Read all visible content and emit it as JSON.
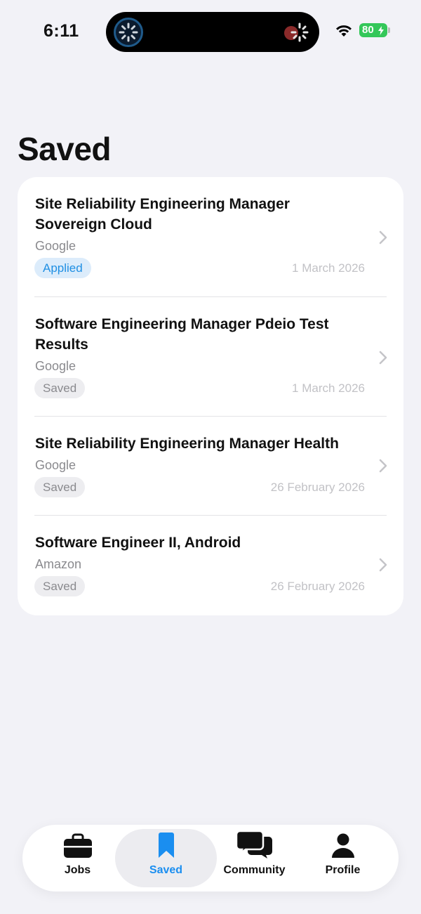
{
  "status_bar": {
    "time": "6:11",
    "battery": "80"
  },
  "page": {
    "title": "Saved"
  },
  "jobs": [
    {
      "title": "Site Reliability Engineering Manager Sovereign Cloud",
      "company": "Google",
      "status": "Applied",
      "date": "1 March 2026"
    },
    {
      "title": "Software Engineering Manager Pdeio Test Results",
      "company": "Google",
      "status": "Saved",
      "date": "1 March 2026"
    },
    {
      "title": "Site Reliability Engineering Manager Health",
      "company": "Google",
      "status": "Saved",
      "date": "26 February 2026"
    },
    {
      "title": "Software Engineer II, Android",
      "company": "Amazon",
      "status": "Saved",
      "date": "26 February 2026"
    }
  ],
  "tabbar": {
    "active": "saved",
    "tabs": [
      {
        "label": "Jobs",
        "icon": "briefcase-icon"
      },
      {
        "label": "Saved",
        "icon": "bookmark-icon"
      },
      {
        "label": "Community",
        "icon": "chat-bubbles-icon"
      },
      {
        "label": "Profile",
        "icon": "person-icon"
      }
    ]
  },
  "colors": {
    "accent": "#1a8ef0",
    "applied_bg": "#dcecfb",
    "battery": "#34c759",
    "background": "#f2f2f7"
  }
}
